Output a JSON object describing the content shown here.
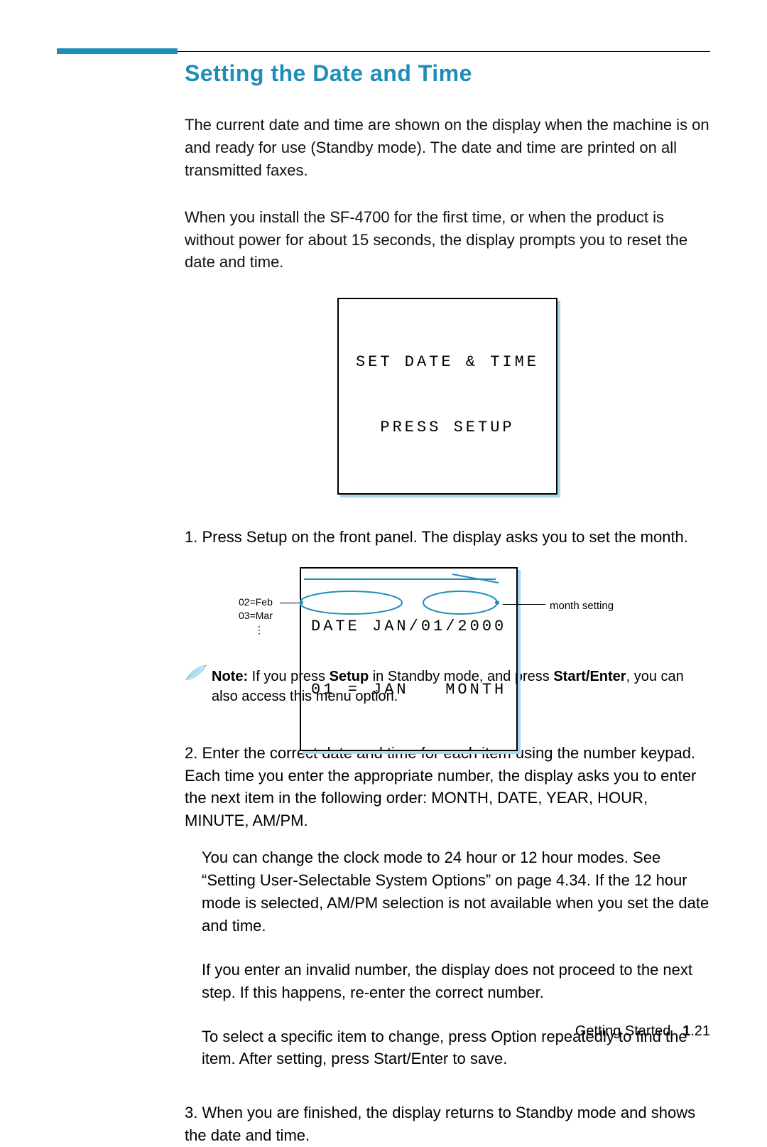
{
  "title": "Setting the Date and Time",
  "intro1": "The current date and time are shown on the display when the machine is on and ready for use (Standby mode). The date and time are printed on all transmitted faxes.",
  "intro2": "When you install the SF-4700 for the first time, or when the product is without power for about 15 seconds, the display prompts you to reset the date and time.",
  "lcd1_line1": "SET DATE & TIME",
  "lcd1_line2": "PRESS SETUP",
  "step1": "1. Press Setup on the front panel. The display asks you to set the month.",
  "diagram2": {
    "key_feb": "02=Feb",
    "key_mar": "03=Mar",
    "lcd_line1": "DATE JAN/01/2000",
    "lcd_line2": "01 = JAN   MONTH",
    "right_label": "month setting"
  },
  "note_label": "Note:",
  "note_text_a": " If you press ",
  "note_bold_a": "Setup",
  "note_text_b": " in Standby mode, and press ",
  "note_bold_b": "Start/Enter",
  "note_text_c": ", you can also access this menu option.",
  "step2_lead": "2. Enter the correct date and time for each item using the number keypad. Each time you enter the appropriate number, the display asks you to enter the next item in the following order: MONTH, DATE, YEAR, HOUR, MINUTE, AM/PM.",
  "step2_para2": "You can change the clock mode to 24 hour or 12 hour modes. See “Setting User-Selectable System Options” on page 4.34. If the 12 hour mode is selected, AM/PM selection is not available when you set the date and time.",
  "step2_para3": "If you enter an invalid number, the display does not proceed to the next step. If this happens, re-enter the correct number.",
  "step2_para4": "To select a specific item to change, press Option repeatedly to find the item. After setting, press Start/Enter to save.",
  "step3": "3. When you are finished, the display returns to Standby mode and shows the date and time.",
  "footer_label": "Getting Started",
  "footer_section": "1",
  "footer_page": ".21"
}
